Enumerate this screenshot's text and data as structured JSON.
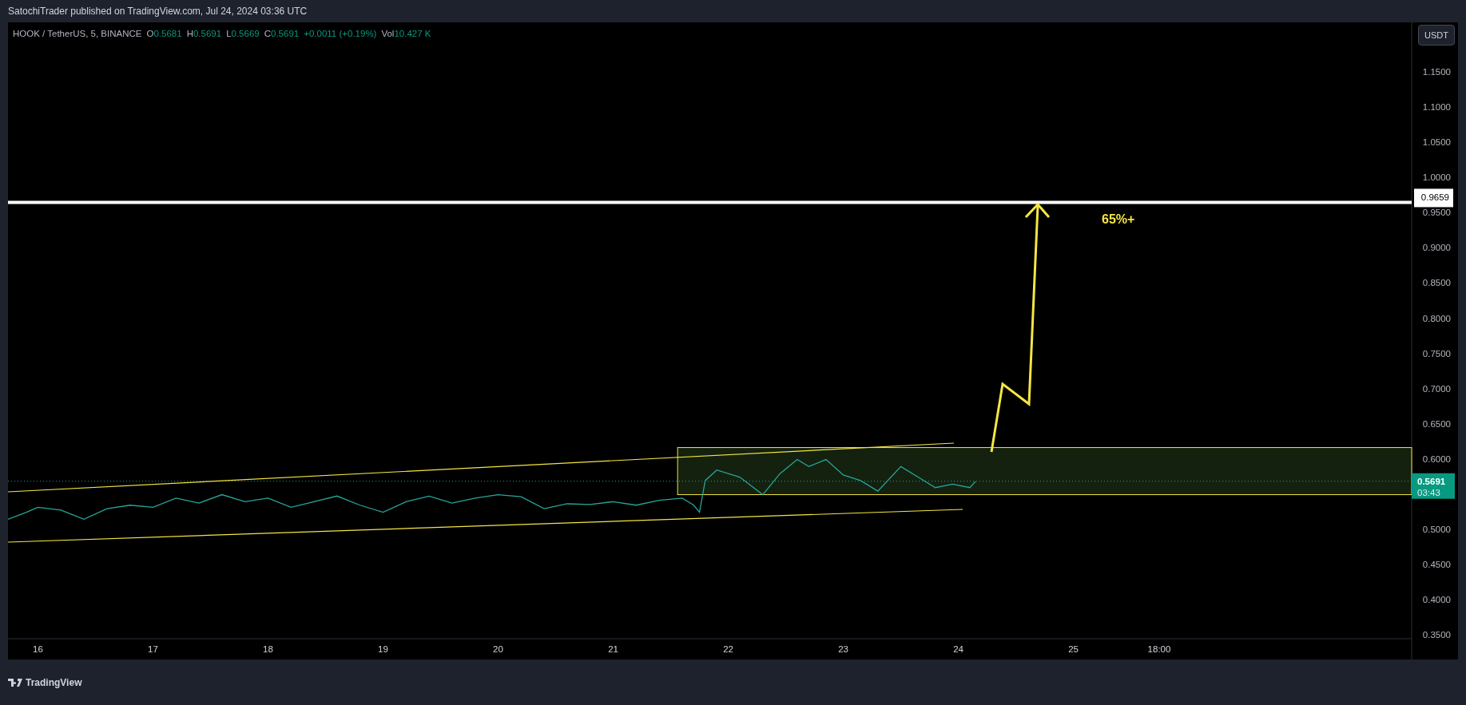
{
  "header": {
    "title": "SatochiTrader published on TradingView.com, Jul 24, 2024 03:36 UTC"
  },
  "legend": {
    "symbol": "HOOK / TetherUS, 5, BINANCE",
    "values": [
      {
        "name": "O",
        "value": "0.5681"
      },
      {
        "name": "H",
        "value": "0.5691"
      },
      {
        "name": "L",
        "value": "0.5669"
      },
      {
        "name": "C",
        "value": "0.5691"
      },
      {
        "value": "+0.0011 (+0.19%)"
      },
      {
        "name": "Vol",
        "value": "10.427 K"
      }
    ]
  },
  "currency_button": {
    "label": "USDT"
  },
  "chart": {
    "chart_data": {
      "type": "line",
      "x": [
        15.74,
        15.9,
        16.0,
        16.2,
        16.4,
        16.6,
        16.8,
        17.0,
        17.2,
        17.4,
        17.6,
        17.8,
        18.0,
        18.2,
        18.4,
        18.6,
        18.8,
        19.0,
        19.2,
        19.4,
        19.6,
        19.8,
        20.0,
        20.2,
        20.4,
        20.6,
        20.8,
        21.0,
        21.2,
        21.4,
        21.6,
        21.7,
        21.75,
        21.8,
        21.9,
        22.1,
        22.3,
        22.45,
        22.6,
        22.7,
        22.85,
        23.0,
        23.15,
        23.3,
        23.5,
        23.65,
        23.8,
        23.95,
        24.1,
        24.15
      ],
      "series": [
        {
          "color": "#26a69a",
          "values": [
            0.515,
            0.525,
            0.532,
            0.528,
            0.515,
            0.53,
            0.535,
            0.532,
            0.545,
            0.538,
            0.55,
            0.54,
            0.545,
            0.532,
            0.54,
            0.548,
            0.535,
            0.525,
            0.54,
            0.548,
            0.538,
            0.545,
            0.55,
            0.547,
            0.53,
            0.537,
            0.536,
            0.54,
            0.535,
            0.542,
            0.545,
            0.535,
            0.525,
            0.57,
            0.585,
            0.575,
            0.55,
            0.58,
            0.6,
            0.59,
            0.6,
            0.578,
            0.57,
            0.555,
            0.59,
            0.575,
            0.56,
            0.565,
            0.56,
            0.569
          ]
        }
      ],
      "xlim": [
        15.74,
        27.94
      ],
      "ylim": [
        0.345,
        1.222
      ],
      "xticks": [
        {
          "value": 16,
          "label": "16"
        },
        {
          "value": 17,
          "label": "17"
        },
        {
          "value": 18,
          "label": "18"
        },
        {
          "value": 19,
          "label": "19"
        },
        {
          "value": 20,
          "label": "20"
        },
        {
          "value": 21,
          "label": "21"
        },
        {
          "value": 22,
          "label": "22"
        },
        {
          "value": 23,
          "label": "23"
        },
        {
          "value": 24,
          "label": "24"
        },
        {
          "value": 25,
          "label": "25"
        }
      ],
      "yticks": [
        {
          "value": 0.35,
          "label": "0.3500"
        },
        {
          "value": 0.4,
          "label": "0.4000"
        },
        {
          "value": 0.45,
          "label": "0.4500"
        },
        {
          "value": 0.5,
          "label": "0.5000"
        },
        {
          "value": 0.6,
          "label": "0.6000"
        },
        {
          "value": 0.65,
          "label": "0.6500"
        },
        {
          "value": 0.7,
          "label": "0.7000"
        },
        {
          "value": 0.75,
          "label": "0.7500"
        },
        {
          "value": 0.8,
          "label": "0.8000"
        },
        {
          "value": 0.85,
          "label": "0.8500"
        },
        {
          "value": 0.9,
          "label": "0.9000"
        },
        {
          "value": 0.95,
          "label": "0.9500"
        },
        {
          "value": 1.0,
          "label": "1.0000"
        },
        {
          "value": 1.05,
          "label": "1.0500"
        },
        {
          "value": 1.1,
          "label": "1.1000"
        },
        {
          "value": 1.15,
          "label": "1.1500"
        }
      ],
      "annotations": [
        "65%+"
      ]
    },
    "time_label": "18:00",
    "target_line": {
      "label": "0.9659"
    },
    "last_price": {
      "value": "0.5691",
      "countdown": "03:43"
    }
  },
  "footer": {
    "brand": "TradingView"
  }
}
